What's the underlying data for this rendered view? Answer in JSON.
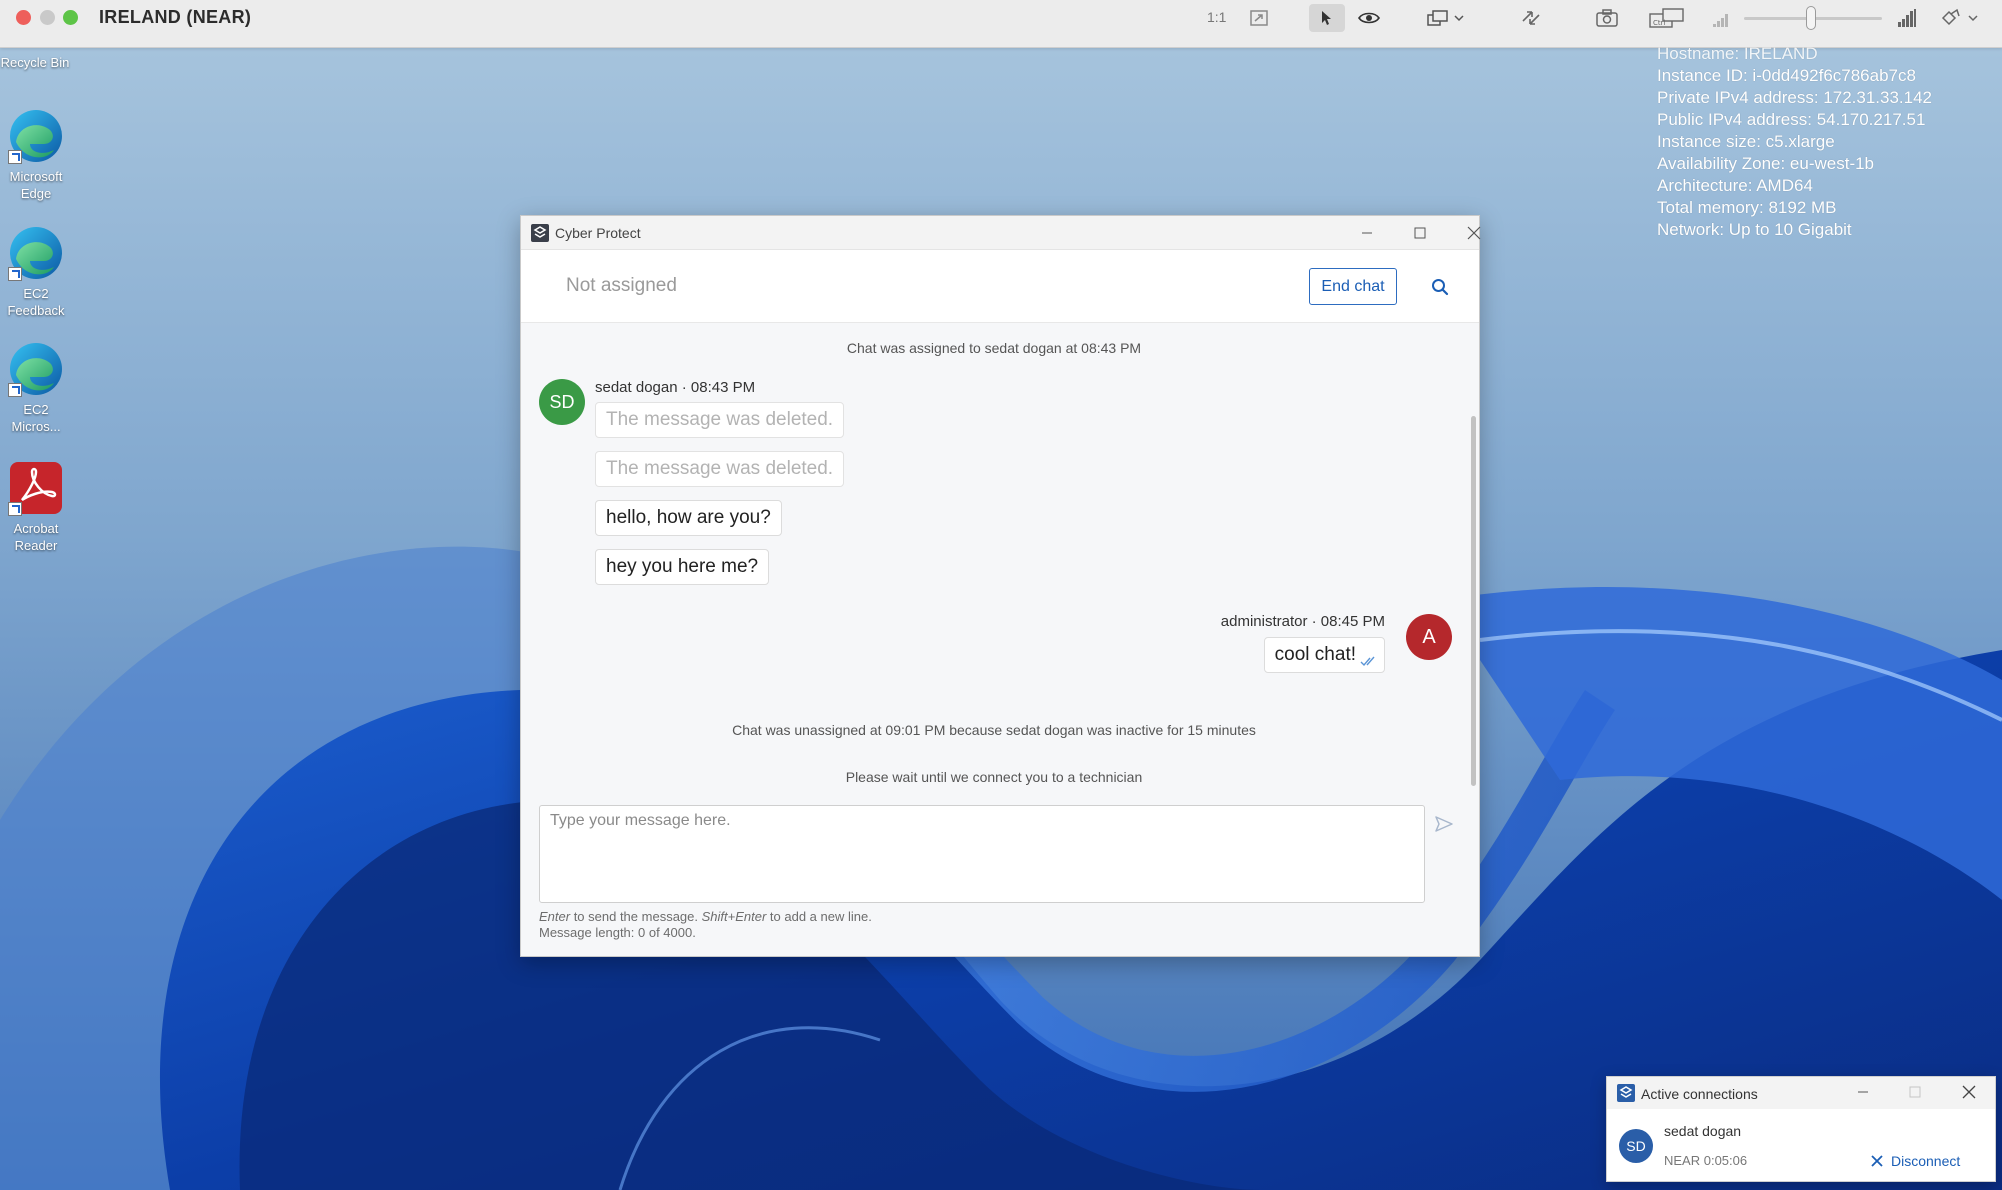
{
  "viewer": {
    "title": "IRELAND (NEAR)",
    "zoom_label": "1:1",
    "toolbar_icons": [
      "fit-screen-icon",
      "remote-control-icon",
      "view-only-icon",
      "multi-monitor-icon",
      "transfer-icon",
      "screenshot-icon",
      "keyboard-icon",
      "quality-low-icon",
      "quality-high-icon",
      "tools-icon"
    ]
  },
  "desktop": {
    "icons": [
      {
        "label": "Recycle Bin",
        "icon": "recycle-bin-icon"
      },
      {
        "label": "Microsoft Edge",
        "icon": "edge-icon"
      },
      {
        "label": "EC2 Feedback",
        "icon": "edge-icon"
      },
      {
        "label": "EC2 Micros...",
        "icon": "edge-icon"
      },
      {
        "label": "Acrobat Reader",
        "icon": "acrobat-icon"
      }
    ],
    "instance_info": [
      "Hostname: IRELAND",
      "Instance ID: i-0dd492f6c786ab7c8",
      "Private IPv4 address: 172.31.33.142",
      "Public IPv4 address: 54.170.217.51",
      "Instance size: c5.xlarge",
      "Availability Zone: eu-west-1b",
      "Architecture: AMD64",
      "Total memory: 8192 MB",
      "Network: Up to 10 Gigabit"
    ]
  },
  "chat_window": {
    "title": "Cyber Protect",
    "status": "Not assigned",
    "end_chat_label": "End chat",
    "system_assigned": "Chat was assigned to sedat dogan at 08:43 PM",
    "incoming": {
      "initials": "SD",
      "author": "sedat dogan · 08:43 PM",
      "messages": [
        "The message was deleted.",
        "The message was deleted.",
        "hello, how are you?",
        "hey you here me?"
      ]
    },
    "outgoing": {
      "initials": "A",
      "author": "administrator · 08:45 PM",
      "message": "cool chat!"
    },
    "system_unassigned": "Chat was unassigned at 09:01 PM because sedat dogan was inactive for 15 minutes",
    "system_wait": "Please wait until we connect you to a technician",
    "composer": {
      "placeholder": "Type your message here.",
      "hint_enter": "Enter",
      "hint_send": " to send the message. ",
      "hint_shift": "Shift+Enter",
      "hint_newline": " to add a new line.",
      "message_length": "Message length: 0 of 4000."
    }
  },
  "active_connections": {
    "title": "Active connections",
    "initials": "SD",
    "user": "sedat dogan",
    "protocol_time": "NEAR  0:05:06",
    "disconnect_label": "Disconnect"
  },
  "colors": {
    "accent": "#1b5eb5",
    "sd_avatar": "#3a9a46",
    "admin_avatar": "#b5282c",
    "conn_avatar": "#2a5ea8"
  }
}
